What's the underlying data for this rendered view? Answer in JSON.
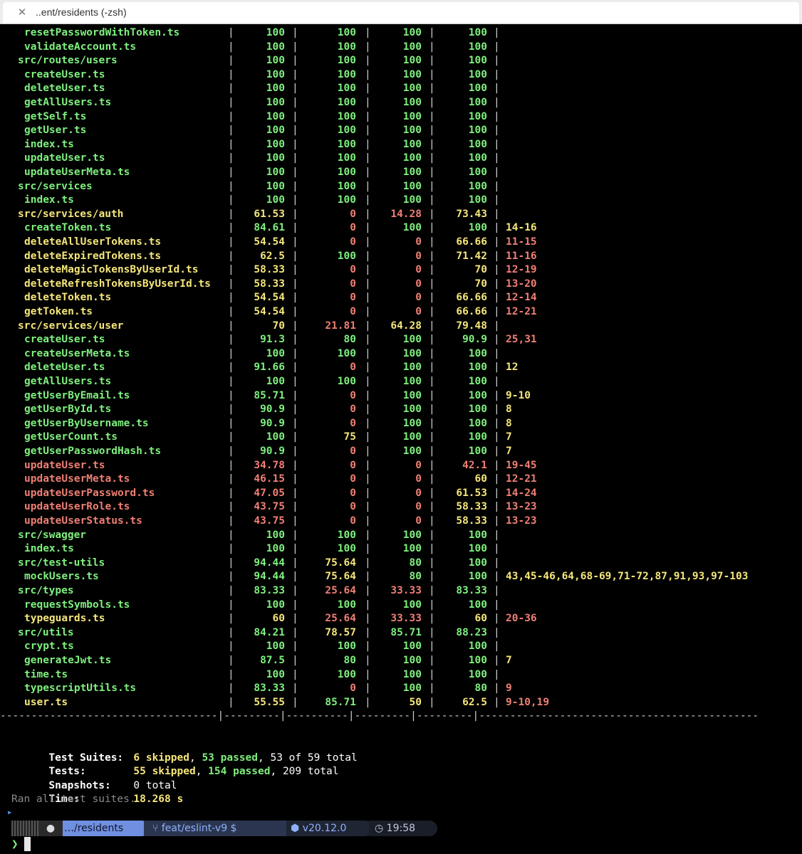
{
  "window": {
    "tab_title": "..ent/residents (-zsh)"
  },
  "coverage_rows": [
    {
      "file": "resetPasswordWithToken.ts",
      "indent": true,
      "fc": "g",
      "stmts": "100",
      "sc": "g",
      "branch": "100",
      "bc": "g",
      "funcs": "100",
      "fnc": "g",
      "lines": "100",
      "lc": "g",
      "uncovered": "",
      "uc": ""
    },
    {
      "file": "validateAccount.ts",
      "indent": true,
      "fc": "g",
      "stmts": "100",
      "sc": "g",
      "branch": "100",
      "bc": "g",
      "funcs": "100",
      "fnc": "g",
      "lines": "100",
      "lc": "g",
      "uncovered": "",
      "uc": ""
    },
    {
      "file": "src/routes/users",
      "indent": false,
      "fc": "g",
      "stmts": "100",
      "sc": "g",
      "branch": "100",
      "bc": "g",
      "funcs": "100",
      "fnc": "g",
      "lines": "100",
      "lc": "g",
      "uncovered": "",
      "uc": ""
    },
    {
      "file": "createUser.ts",
      "indent": true,
      "fc": "g",
      "stmts": "100",
      "sc": "g",
      "branch": "100",
      "bc": "g",
      "funcs": "100",
      "fnc": "g",
      "lines": "100",
      "lc": "g",
      "uncovered": "",
      "uc": ""
    },
    {
      "file": "deleteUser.ts",
      "indent": true,
      "fc": "g",
      "stmts": "100",
      "sc": "g",
      "branch": "100",
      "bc": "g",
      "funcs": "100",
      "fnc": "g",
      "lines": "100",
      "lc": "g",
      "uncovered": "",
      "uc": ""
    },
    {
      "file": "getAllUsers.ts",
      "indent": true,
      "fc": "g",
      "stmts": "100",
      "sc": "g",
      "branch": "100",
      "bc": "g",
      "funcs": "100",
      "fnc": "g",
      "lines": "100",
      "lc": "g",
      "uncovered": "",
      "uc": ""
    },
    {
      "file": "getSelf.ts",
      "indent": true,
      "fc": "g",
      "stmts": "100",
      "sc": "g",
      "branch": "100",
      "bc": "g",
      "funcs": "100",
      "fnc": "g",
      "lines": "100",
      "lc": "g",
      "uncovered": "",
      "uc": ""
    },
    {
      "file": "getUser.ts",
      "indent": true,
      "fc": "g",
      "stmts": "100",
      "sc": "g",
      "branch": "100",
      "bc": "g",
      "funcs": "100",
      "fnc": "g",
      "lines": "100",
      "lc": "g",
      "uncovered": "",
      "uc": ""
    },
    {
      "file": "index.ts",
      "indent": true,
      "fc": "g",
      "stmts": "100",
      "sc": "g",
      "branch": "100",
      "bc": "g",
      "funcs": "100",
      "fnc": "g",
      "lines": "100",
      "lc": "g",
      "uncovered": "",
      "uc": ""
    },
    {
      "file": "updateUser.ts",
      "indent": true,
      "fc": "g",
      "stmts": "100",
      "sc": "g",
      "branch": "100",
      "bc": "g",
      "funcs": "100",
      "fnc": "g",
      "lines": "100",
      "lc": "g",
      "uncovered": "",
      "uc": ""
    },
    {
      "file": "updateUserMeta.ts",
      "indent": true,
      "fc": "g",
      "stmts": "100",
      "sc": "g",
      "branch": "100",
      "bc": "g",
      "funcs": "100",
      "fnc": "g",
      "lines": "100",
      "lc": "g",
      "uncovered": "",
      "uc": ""
    },
    {
      "file": "src/services",
      "indent": false,
      "fc": "g",
      "stmts": "100",
      "sc": "g",
      "branch": "100",
      "bc": "g",
      "funcs": "100",
      "fnc": "g",
      "lines": "100",
      "lc": "g",
      "uncovered": "",
      "uc": ""
    },
    {
      "file": "index.ts",
      "indent": true,
      "fc": "g",
      "stmts": "100",
      "sc": "g",
      "branch": "100",
      "bc": "g",
      "funcs": "100",
      "fnc": "g",
      "lines": "100",
      "lc": "g",
      "uncovered": "",
      "uc": ""
    },
    {
      "file": "src/services/auth",
      "indent": false,
      "fc": "y",
      "stmts": "61.53",
      "sc": "y",
      "branch": "0",
      "bc": "r",
      "funcs": "14.28",
      "fnc": "r",
      "lines": "73.43",
      "lc": "y",
      "uncovered": "",
      "uc": ""
    },
    {
      "file": "createToken.ts",
      "indent": true,
      "fc": "g",
      "stmts": "84.61",
      "sc": "g",
      "branch": "0",
      "bc": "r",
      "funcs": "100",
      "fnc": "g",
      "lines": "100",
      "lc": "g",
      "uncovered": "14-16",
      "uc": "y"
    },
    {
      "file": "deleteAllUserTokens.ts",
      "indent": true,
      "fc": "y",
      "stmts": "54.54",
      "sc": "y",
      "branch": "0",
      "bc": "r",
      "funcs": "0",
      "fnc": "r",
      "lines": "66.66",
      "lc": "y",
      "uncovered": "11-15",
      "uc": "r"
    },
    {
      "file": "deleteExpiredTokens.ts",
      "indent": true,
      "fc": "y",
      "stmts": "62.5",
      "sc": "y",
      "branch": "100",
      "bc": "g",
      "funcs": "0",
      "fnc": "r",
      "lines": "71.42",
      "lc": "y",
      "uncovered": "11-16",
      "uc": "r"
    },
    {
      "file": "deleteMagicTokensByUserId.ts",
      "indent": true,
      "fc": "y",
      "stmts": "58.33",
      "sc": "y",
      "branch": "0",
      "bc": "r",
      "funcs": "0",
      "fnc": "r",
      "lines": "70",
      "lc": "y",
      "uncovered": "12-19",
      "uc": "r"
    },
    {
      "file": "deleteRefreshTokensByUserId.ts",
      "indent": true,
      "fc": "y",
      "stmts": "58.33",
      "sc": "y",
      "branch": "0",
      "bc": "r",
      "funcs": "0",
      "fnc": "r",
      "lines": "70",
      "lc": "y",
      "uncovered": "13-20",
      "uc": "r"
    },
    {
      "file": "deleteToken.ts",
      "indent": true,
      "fc": "y",
      "stmts": "54.54",
      "sc": "y",
      "branch": "0",
      "bc": "r",
      "funcs": "0",
      "fnc": "r",
      "lines": "66.66",
      "lc": "y",
      "uncovered": "12-14",
      "uc": "r"
    },
    {
      "file": "getToken.ts",
      "indent": true,
      "fc": "y",
      "stmts": "54.54",
      "sc": "y",
      "branch": "0",
      "bc": "r",
      "funcs": "0",
      "fnc": "r",
      "lines": "66.66",
      "lc": "y",
      "uncovered": "12-21",
      "uc": "r"
    },
    {
      "file": "src/services/user",
      "indent": false,
      "fc": "y",
      "stmts": "70",
      "sc": "y",
      "branch": "21.81",
      "bc": "r",
      "funcs": "64.28",
      "fnc": "y",
      "lines": "79.48",
      "lc": "y",
      "uncovered": "",
      "uc": ""
    },
    {
      "file": "createUser.ts",
      "indent": true,
      "fc": "g",
      "stmts": "91.3",
      "sc": "g",
      "branch": "80",
      "bc": "g",
      "funcs": "100",
      "fnc": "g",
      "lines": "90.9",
      "lc": "g",
      "uncovered": "25,31",
      "uc": "r"
    },
    {
      "file": "createUserMeta.ts",
      "indent": true,
      "fc": "g",
      "stmts": "100",
      "sc": "g",
      "branch": "100",
      "bc": "g",
      "funcs": "100",
      "fnc": "g",
      "lines": "100",
      "lc": "g",
      "uncovered": "",
      "uc": ""
    },
    {
      "file": "deleteUser.ts",
      "indent": true,
      "fc": "g",
      "stmts": "91.66",
      "sc": "g",
      "branch": "0",
      "bc": "r",
      "funcs": "100",
      "fnc": "g",
      "lines": "100",
      "lc": "g",
      "uncovered": "12",
      "uc": "y"
    },
    {
      "file": "getAllUsers.ts",
      "indent": true,
      "fc": "g",
      "stmts": "100",
      "sc": "g",
      "branch": "100",
      "bc": "g",
      "funcs": "100",
      "fnc": "g",
      "lines": "100",
      "lc": "g",
      "uncovered": "",
      "uc": ""
    },
    {
      "file": "getUserByEmail.ts",
      "indent": true,
      "fc": "g",
      "stmts": "85.71",
      "sc": "g",
      "branch": "0",
      "bc": "r",
      "funcs": "100",
      "fnc": "g",
      "lines": "100",
      "lc": "g",
      "uncovered": "9-10",
      "uc": "y"
    },
    {
      "file": "getUserById.ts",
      "indent": true,
      "fc": "g",
      "stmts": "90.9",
      "sc": "g",
      "branch": "0",
      "bc": "r",
      "funcs": "100",
      "fnc": "g",
      "lines": "100",
      "lc": "g",
      "uncovered": "8",
      "uc": "y"
    },
    {
      "file": "getUserByUsername.ts",
      "indent": true,
      "fc": "g",
      "stmts": "90.9",
      "sc": "g",
      "branch": "0",
      "bc": "r",
      "funcs": "100",
      "fnc": "g",
      "lines": "100",
      "lc": "g",
      "uncovered": "8",
      "uc": "y"
    },
    {
      "file": "getUserCount.ts",
      "indent": true,
      "fc": "g",
      "stmts": "100",
      "sc": "g",
      "branch": "75",
      "bc": "y",
      "funcs": "100",
      "fnc": "g",
      "lines": "100",
      "lc": "g",
      "uncovered": "7",
      "uc": "y"
    },
    {
      "file": "getUserPasswordHash.ts",
      "indent": true,
      "fc": "g",
      "stmts": "90.9",
      "sc": "g",
      "branch": "0",
      "bc": "r",
      "funcs": "100",
      "fnc": "g",
      "lines": "100",
      "lc": "g",
      "uncovered": "7",
      "uc": "y"
    },
    {
      "file": "updateUser.ts",
      "indent": true,
      "fc": "r",
      "stmts": "34.78",
      "sc": "r",
      "branch": "0",
      "bc": "r",
      "funcs": "0",
      "fnc": "r",
      "lines": "42.1",
      "lc": "r",
      "uncovered": "19-45",
      "uc": "r"
    },
    {
      "file": "updateUserMeta.ts",
      "indent": true,
      "fc": "r",
      "stmts": "46.15",
      "sc": "r",
      "branch": "0",
      "bc": "r",
      "funcs": "0",
      "fnc": "r",
      "lines": "60",
      "lc": "y",
      "uncovered": "12-21",
      "uc": "r"
    },
    {
      "file": "updateUserPassword.ts",
      "indent": true,
      "fc": "r",
      "stmts": "47.05",
      "sc": "r",
      "branch": "0",
      "bc": "r",
      "funcs": "0",
      "fnc": "r",
      "lines": "61.53",
      "lc": "y",
      "uncovered": "14-24",
      "uc": "r"
    },
    {
      "file": "updateUserRole.ts",
      "indent": true,
      "fc": "r",
      "stmts": "43.75",
      "sc": "r",
      "branch": "0",
      "bc": "r",
      "funcs": "0",
      "fnc": "r",
      "lines": "58.33",
      "lc": "y",
      "uncovered": "13-23",
      "uc": "r"
    },
    {
      "file": "updateUserStatus.ts",
      "indent": true,
      "fc": "r",
      "stmts": "43.75",
      "sc": "r",
      "branch": "0",
      "bc": "r",
      "funcs": "0",
      "fnc": "r",
      "lines": "58.33",
      "lc": "y",
      "uncovered": "13-23",
      "uc": "r"
    },
    {
      "file": "src/swagger",
      "indent": false,
      "fc": "g",
      "stmts": "100",
      "sc": "g",
      "branch": "100",
      "bc": "g",
      "funcs": "100",
      "fnc": "g",
      "lines": "100",
      "lc": "g",
      "uncovered": "",
      "uc": ""
    },
    {
      "file": "index.ts",
      "indent": true,
      "fc": "g",
      "stmts": "100",
      "sc": "g",
      "branch": "100",
      "bc": "g",
      "funcs": "100",
      "fnc": "g",
      "lines": "100",
      "lc": "g",
      "uncovered": "",
      "uc": ""
    },
    {
      "file": "src/test-utils",
      "indent": false,
      "fc": "g",
      "stmts": "94.44",
      "sc": "g",
      "branch": "75.64",
      "bc": "y",
      "funcs": "80",
      "fnc": "g",
      "lines": "100",
      "lc": "g",
      "uncovered": "",
      "uc": ""
    },
    {
      "file": "mockUsers.ts",
      "indent": true,
      "fc": "g",
      "stmts": "94.44",
      "sc": "g",
      "branch": "75.64",
      "bc": "y",
      "funcs": "80",
      "fnc": "g",
      "lines": "100",
      "lc": "g",
      "uncovered": "43,45-46,64,68-69,71-72,87,91,93,97-103",
      "uc": "y"
    },
    {
      "file": "src/types",
      "indent": false,
      "fc": "g",
      "stmts": "83.33",
      "sc": "g",
      "branch": "25.64",
      "bc": "r",
      "funcs": "33.33",
      "fnc": "r",
      "lines": "83.33",
      "lc": "g",
      "uncovered": "",
      "uc": ""
    },
    {
      "file": "requestSymbols.ts",
      "indent": true,
      "fc": "g",
      "stmts": "100",
      "sc": "g",
      "branch": "100",
      "bc": "g",
      "funcs": "100",
      "fnc": "g",
      "lines": "100",
      "lc": "g",
      "uncovered": "",
      "uc": ""
    },
    {
      "file": "typeguards.ts",
      "indent": true,
      "fc": "y",
      "stmts": "60",
      "sc": "y",
      "branch": "25.64",
      "bc": "r",
      "funcs": "33.33",
      "fnc": "r",
      "lines": "60",
      "lc": "y",
      "uncovered": "20-36",
      "uc": "r"
    },
    {
      "file": "src/utils",
      "indent": false,
      "fc": "g",
      "stmts": "84.21",
      "sc": "g",
      "branch": "78.57",
      "bc": "y",
      "funcs": "85.71",
      "fnc": "g",
      "lines": "88.23",
      "lc": "g",
      "uncovered": "",
      "uc": ""
    },
    {
      "file": "crypt.ts",
      "indent": true,
      "fc": "g",
      "stmts": "100",
      "sc": "g",
      "branch": "100",
      "bc": "g",
      "funcs": "100",
      "fnc": "g",
      "lines": "100",
      "lc": "g",
      "uncovered": "",
      "uc": ""
    },
    {
      "file": "generateJwt.ts",
      "indent": true,
      "fc": "g",
      "stmts": "87.5",
      "sc": "g",
      "branch": "80",
      "bc": "g",
      "funcs": "100",
      "fnc": "g",
      "lines": "100",
      "lc": "g",
      "uncovered": "7",
      "uc": "y"
    },
    {
      "file": "time.ts",
      "indent": true,
      "fc": "g",
      "stmts": "100",
      "sc": "g",
      "branch": "100",
      "bc": "g",
      "funcs": "100",
      "fnc": "g",
      "lines": "100",
      "lc": "g",
      "uncovered": "",
      "uc": ""
    },
    {
      "file": "typescriptUtils.ts",
      "indent": true,
      "fc": "g",
      "stmts": "83.33",
      "sc": "g",
      "branch": "0",
      "bc": "r",
      "funcs": "100",
      "fnc": "g",
      "lines": "80",
      "lc": "g",
      "uncovered": "9",
      "uc": "r"
    },
    {
      "file": "user.ts",
      "indent": true,
      "fc": "y",
      "stmts": "55.55",
      "sc": "y",
      "branch": "85.71",
      "bc": "g",
      "funcs": "50",
      "fnc": "y",
      "lines": "62.5",
      "lc": "y",
      "uncovered": "9-10,19",
      "uc": "r"
    }
  ],
  "table_footer": "-----------------------------------|---------|----------|---------|---------|---------------------------------------------",
  "summary": {
    "suites_label": "Test Suites:",
    "suites_skipped": "6 skipped",
    "suites_passed": "53 passed",
    "suites_total": "53 of 59 total",
    "tests_label": "Tests:",
    "tests_skipped": "55 skipped",
    "tests_passed": "154 passed",
    "tests_total": "209 total",
    "snapshots_label": "Snapshots:",
    "snapshots_value": "0 total",
    "time_label": "Time:",
    "time_value": "18.268 s",
    "ran_all": "Ran all test suites."
  },
  "prompt": {
    "path": "…/residents",
    "branch": "feat/eslint-v9 $",
    "node_version": "v20.12.0",
    "clock": "19:58",
    "caret": "❯"
  },
  "colors": {
    "green": "#7ef07e",
    "yellow": "#f5e67a",
    "red": "#f07f74",
    "path_segment": "#6f8fe0",
    "git_segment": "#2b3550",
    "node_segment": "#1f2533"
  }
}
